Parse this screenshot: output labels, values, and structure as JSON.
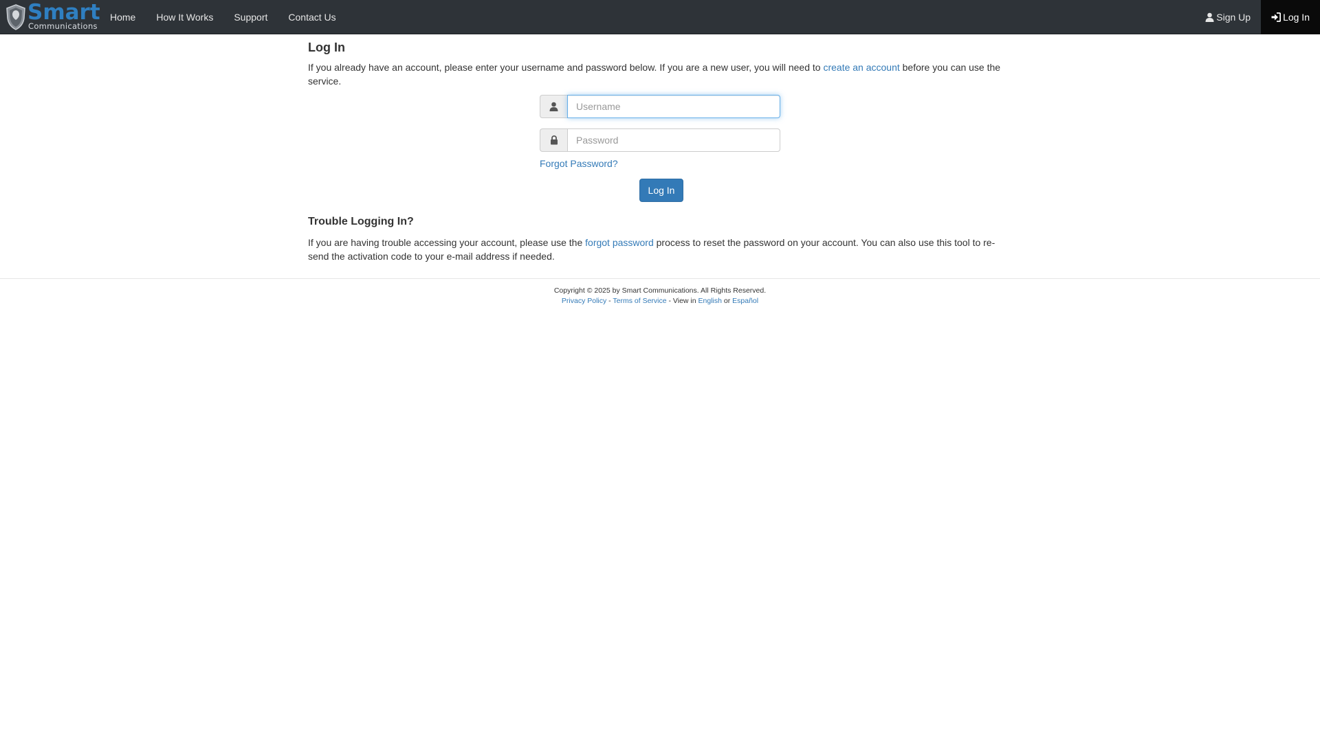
{
  "brand": {
    "name": "Smart",
    "subtitle": "Communications",
    "logo_icon": "shield-icon"
  },
  "nav": {
    "left": [
      {
        "label": "Home"
      },
      {
        "label": "How It Works"
      },
      {
        "label": "Support"
      },
      {
        "label": "Contact Us"
      }
    ],
    "right": [
      {
        "label": "Sign Up",
        "icon": "user-icon"
      },
      {
        "label": "Log In",
        "icon": "login-icon",
        "active": true
      }
    ]
  },
  "login": {
    "title": "Log In",
    "intro_before": "If you already have an account, please enter your username and password below. If you are a new user, you will need to ",
    "intro_link": "create an account",
    "intro_after": " before you can use the service.",
    "username_placeholder": "Username",
    "username_value": "",
    "username_icon": "user-icon",
    "password_placeholder": "Password",
    "password_value": "",
    "password_icon": "lock-icon",
    "forgot_label": "Forgot Password?",
    "submit_label": "Log In"
  },
  "trouble": {
    "title": "Trouble Logging In?",
    "text_before": "If you are having trouble accessing your account, please use the ",
    "link": "forgot password",
    "text_after": " process to reset the password on your account. You can also use this tool to re-send the activation code to your e-mail address if needed."
  },
  "footer": {
    "copyright": "Copyright © 2025 by Smart Communications. All Rights Reserved.",
    "privacy": "Privacy Policy",
    "sep1": " - ",
    "terms": "Terms of Service",
    "view_in": " - View in ",
    "english": "English",
    "or": " or ",
    "spanish": "Español"
  },
  "colors": {
    "navbar_bg": "#2e3338",
    "active_nav_bg": "#0a0a0a",
    "brand_blue": "#2f7fc1",
    "link": "#337ab7",
    "primary_button": "#337ab7",
    "focus_border": "#66afe9"
  }
}
